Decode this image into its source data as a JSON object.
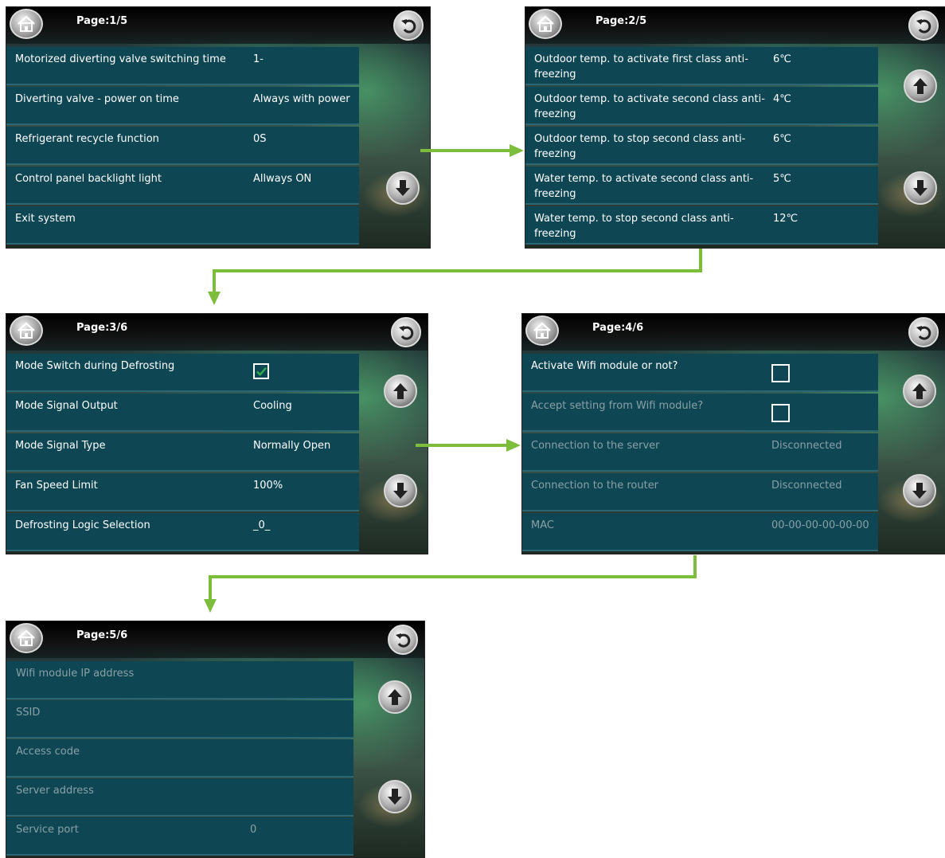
{
  "screens": [
    {
      "page": "Page:1/5",
      "rows": [
        {
          "label": "Motorized diverting valve switching time",
          "value": "1-"
        },
        {
          "label": "Diverting valve - power on time",
          "value": "Always with power"
        },
        {
          "label": "Refrigerant recycle function",
          "value": "0S"
        },
        {
          "label": "Control panel backlight light",
          "value": "Allways ON"
        },
        {
          "label": "Exit system",
          "value": ""
        }
      ]
    },
    {
      "page": "Page:2/5",
      "rows": [
        {
          "label": "Outdoor temp. to activate first class anti-",
          "label2": "freezing",
          "value": "6℃"
        },
        {
          "label": "Outdoor temp. to activate second class anti-",
          "label2": "freezing",
          "value": "4℃"
        },
        {
          "label": "Outdoor temp. to stop second class anti-",
          "label2": "freezing",
          "value": "6℃"
        },
        {
          "label": "Water temp. to activate second class anti-",
          "label2": "freezing",
          "value": "5℃"
        },
        {
          "label": "Water temp. to stop second class anti-",
          "label2": "freezing",
          "value": "12℃"
        }
      ]
    },
    {
      "page": "Page:3/6",
      "rows": [
        {
          "label": "Mode Switch during Defrosting",
          "value": "",
          "checkbox": true,
          "checked": true
        },
        {
          "label": "Mode Signal Output",
          "value": "Cooling"
        },
        {
          "label": "Mode Signal Type",
          "value": "Normally Open"
        },
        {
          "label": "Fan Speed Limit",
          "value": "100%"
        },
        {
          "label": "Defrosting Logic Selection",
          "value": "_0_"
        }
      ]
    },
    {
      "page": "Page:4/6",
      "rows": [
        {
          "label": "Activate Wifi module or not?",
          "value": "",
          "checkbox": true,
          "checked": false
        },
        {
          "label": "Accept setting from Wifi module?",
          "value": "",
          "checkbox": true,
          "checked": false
        },
        {
          "label": "Connection to the server",
          "value": "Disconnected"
        },
        {
          "label": "Connection to the router",
          "value": "Disconnected"
        },
        {
          "label": "MAC",
          "value": "00-00-00-00-00-00"
        }
      ]
    },
    {
      "page": "Page:5/6",
      "rows": [
        {
          "label": "Wifi module IP address",
          "value": ""
        },
        {
          "label": "SSID",
          "value": ""
        },
        {
          "label": "Access code",
          "value": ""
        },
        {
          "label": "Server address",
          "value": ""
        },
        {
          "label": "Service port",
          "value": "0"
        }
      ]
    }
  ],
  "colors": {
    "row_bg": "#0e4654",
    "flow_arrow": "#7dbd3c",
    "dim_text": "#8aa0a6",
    "check": "#2fb24a"
  },
  "icons": {
    "home": "home-icon",
    "back": "back-arrow-icon",
    "up": "up-arrow-icon",
    "down": "down-arrow-icon"
  }
}
